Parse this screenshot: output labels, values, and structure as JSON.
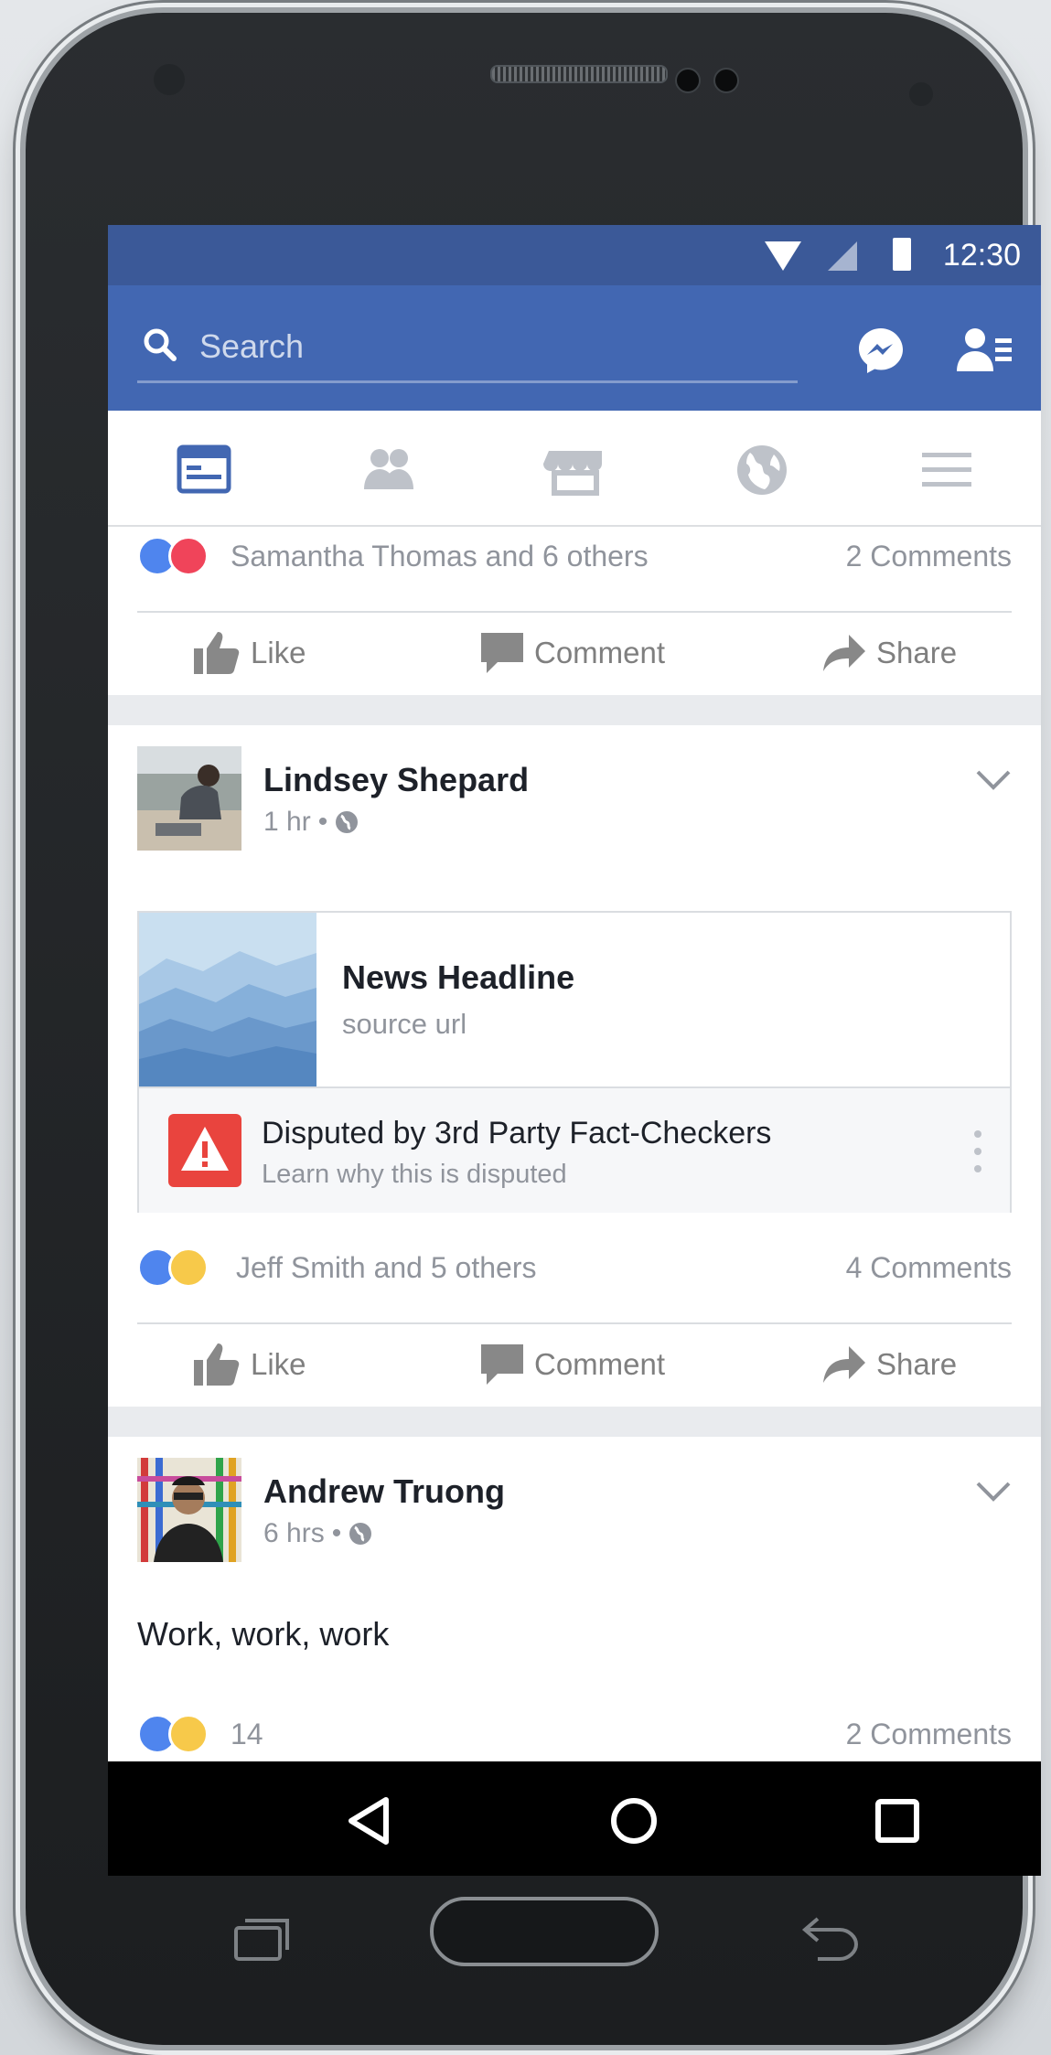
{
  "status_bar": {
    "time": "12:30"
  },
  "search": {
    "placeholder": "Search"
  },
  "posts": [
    {
      "reactions_text": "Samantha Thomas and 6 others",
      "comments_label": "2 Comments",
      "actions": {
        "like": "Like",
        "comment": "Comment",
        "share": "Share"
      }
    },
    {
      "author": "Lindsey Shepard",
      "time": "1 hr",
      "link": {
        "headline": "News Headline",
        "source": "source url",
        "dispute_title": "Disputed by 3rd Party Fact-Checkers",
        "dispute_sub": "Learn why this is disputed"
      },
      "reactions_text": "Jeff Smith and 5 others",
      "comments_label": "4 Comments",
      "actions": {
        "like": "Like",
        "comment": "Comment",
        "share": "Share"
      }
    },
    {
      "author": "Andrew Truong",
      "time": "6 hrs",
      "body": "Work, work, work",
      "reactions_text": "14",
      "comments_label": "2 Comments"
    }
  ],
  "meta_separator": "•",
  "colors": {
    "brand_blue": "#4267b2",
    "status_blue": "#3b5998",
    "dispute_red": "#e9443e",
    "like_blue": "#4f85ee",
    "love_red": "#f0445a",
    "wow_yellow": "#f7c94a"
  },
  "icons": {
    "tabs": [
      "news-feed-icon",
      "friends-icon",
      "marketplace-icon",
      "notifications-globe-icon",
      "menu-icon"
    ],
    "nav": [
      "back-icon",
      "home-icon",
      "recents-icon"
    ]
  }
}
